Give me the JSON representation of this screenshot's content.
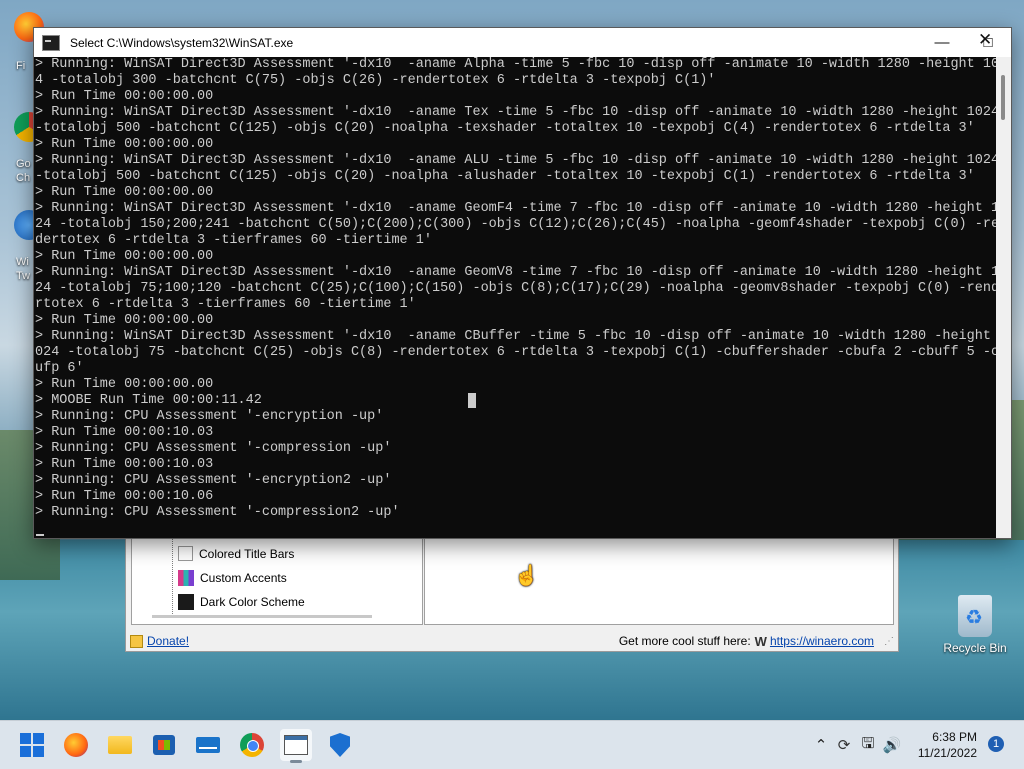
{
  "console": {
    "title": "Select C:\\Windows\\system32\\WinSAT.exe",
    "lines": [
      "> Running: WinSAT Direct3D Assessment '-dx10  -aname Alpha -time 5 -fbc 10 -disp off -animate 10 -width 1280 -height 102",
      "4 -totalobj 300 -batchcnt C(75) -objs C(26) -rendertotex 6 -rtdelta 3 -texpobj C(1)'",
      "> Run Time 00:00:00.00",
      "> Running: WinSAT Direct3D Assessment '-dx10  -aname Tex -time 5 -fbc 10 -disp off -animate 10 -width 1280 -height 1024",
      "-totalobj 500 -batchcnt C(125) -objs C(20) -noalpha -texshader -totaltex 10 -texpobj C(4) -rendertotex 6 -rtdelta 3'",
      "> Run Time 00:00:00.00",
      "> Running: WinSAT Direct3D Assessment '-dx10  -aname ALU -time 5 -fbc 10 -disp off -animate 10 -width 1280 -height 1024",
      "-totalobj 500 -batchcnt C(125) -objs C(20) -noalpha -alushader -totaltex 10 -texpobj C(1) -rendertotex 6 -rtdelta 3'",
      "> Run Time 00:00:00.00",
      "> Running: WinSAT Direct3D Assessment '-dx10  -aname GeomF4 -time 7 -fbc 10 -disp off -animate 10 -width 1280 -height 10",
      "24 -totalobj 150;200;241 -batchcnt C(50);C(200);C(300) -objs C(12);C(26);C(45) -noalpha -geomf4shader -texpobj C(0) -ren",
      "dertotex 6 -rtdelta 3 -tierframes 60 -tiertime 1'",
      "> Run Time 00:00:00.00",
      "> Running: WinSAT Direct3D Assessment '-dx10  -aname GeomV8 -time 7 -fbc 10 -disp off -animate 10 -width 1280 -height 10",
      "24 -totalobj 75;100;120 -batchcnt C(25);C(100);C(150) -objs C(8);C(17);C(29) -noalpha -geomv8shader -texpobj C(0) -rende",
      "rtotex 6 -rtdelta 3 -tierframes 60 -tiertime 1'",
      "> Run Time 00:00:00.00",
      "> Running: WinSAT Direct3D Assessment '-dx10  -aname CBuffer -time 5 -fbc 10 -disp off -animate 10 -width 1280 -height 1",
      "024 -totalobj 75 -batchcnt C(25) -objs C(8) -rendertotex 6 -rtdelta 3 -texpobj C(1) -cbuffershader -cbufa 2 -cbuff 5 -cb",
      "ufp 6'",
      "> Run Time 00:00:00.00",
      "> MOOBE Run Time 00:00:11.42",
      "> Running: CPU Assessment '-encryption -up'",
      "> Run Time 00:00:10.03",
      "> Running: CPU Assessment '-compression -up'",
      "> Run Time 00:00:10.03",
      "> Running: CPU Assessment '-encryption2 -up'",
      "> Run Time 00:00:10.06",
      "> Running: CPU Assessment '-compression2 -up'"
    ]
  },
  "app": {
    "tree_items": [
      {
        "label": "Colored Title Bars",
        "swatch": "#ffffff"
      },
      {
        "label": "Custom Accents",
        "swatch": "#d43a8a"
      },
      {
        "label": "Dark Color Scheme",
        "swatch": "#1a1a1a"
      }
    ],
    "status_donate": "Donate!",
    "status_more": "Get more cool stuff here:",
    "status_link": "https://winaero.com"
  },
  "desktop": {
    "recycle_label": "Recycle Bin",
    "partial_labels": [
      "Fi",
      "Go",
      "Ch",
      "Wi",
      "Tw"
    ]
  },
  "taskbar": {
    "time": "6:38 PM",
    "date": "11/21/2022",
    "notification_count": "1",
    "apps": [
      "start-icon",
      "firefox-icon",
      "file-explorer-icon",
      "store-icon",
      "mail-icon",
      "chrome-icon",
      "winaero-tweaker-icon",
      "defender-icon"
    ]
  }
}
